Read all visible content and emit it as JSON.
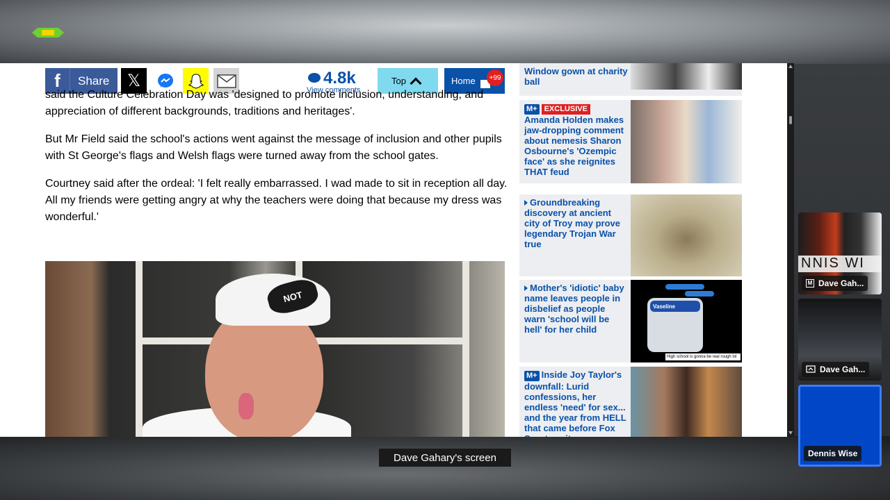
{
  "meeting": {
    "caption": "Dave Gahary's screen",
    "participants": [
      {
        "name": "Dave Gah...",
        "icon": "M"
      },
      {
        "name": "Dave Gah...",
        "icon": "share-screen-icon"
      },
      {
        "name": "Dennis Wise",
        "icon": ""
      }
    ],
    "thumb_watermark": "NNIS    WI"
  },
  "sharebar": {
    "share_label": "Share",
    "comments_count": "4.8k",
    "comments_label": "View comments",
    "top_label": "Top",
    "home_label": "Home",
    "home_badge": "+99"
  },
  "article": {
    "paragraph_cut": "said the Culture Celebration Day was 'designed to promote inclusion, understanding, and appreciation of different backgrounds, traditions and heritages'.",
    "paragraph_2": "But Mr Field said the school's actions went against the message of inclusion and other pupils with St George's flags and Welsh flags were turned away from the school gates.",
    "paragraph_3": "Courtney said after the ordeal: 'I felt really embarrassed. I wad made to sit in reception all day. All my friends were getting angry at why the teachers were doing that because my dress was wonderful.'",
    "photo_cap_text": "NOT"
  },
  "sidebar": {
    "cards": [
      {
        "tag": "",
        "title": "Window gown at charity ball"
      },
      {
        "tag": "EXCLUSIVE",
        "badge": "M+",
        "title": "Amanda Holden makes jaw-dropping comment about nemesis Sharon Osbourne's 'Ozempic face' as she reignites THAT feud"
      },
      {
        "tag": "",
        "title": "Groundbreaking discovery at ancient city of Troy may prove legendary Trojan War true"
      },
      {
        "tag": "",
        "title": "Mother's 'idiotic' baby name leaves people in disbelief as people warn 'school will be hell' for her child"
      },
      {
        "tag": "",
        "badge": "M+",
        "title": "Inside Joy Taylor's downfall: Lurid confessions, her endless 'need' for sex... and the year from HELL that came before Fox Sports exit"
      }
    ],
    "vaseline_caption": "High school is gonna be real rough lol",
    "vaseline_label": "Vaseline"
  }
}
